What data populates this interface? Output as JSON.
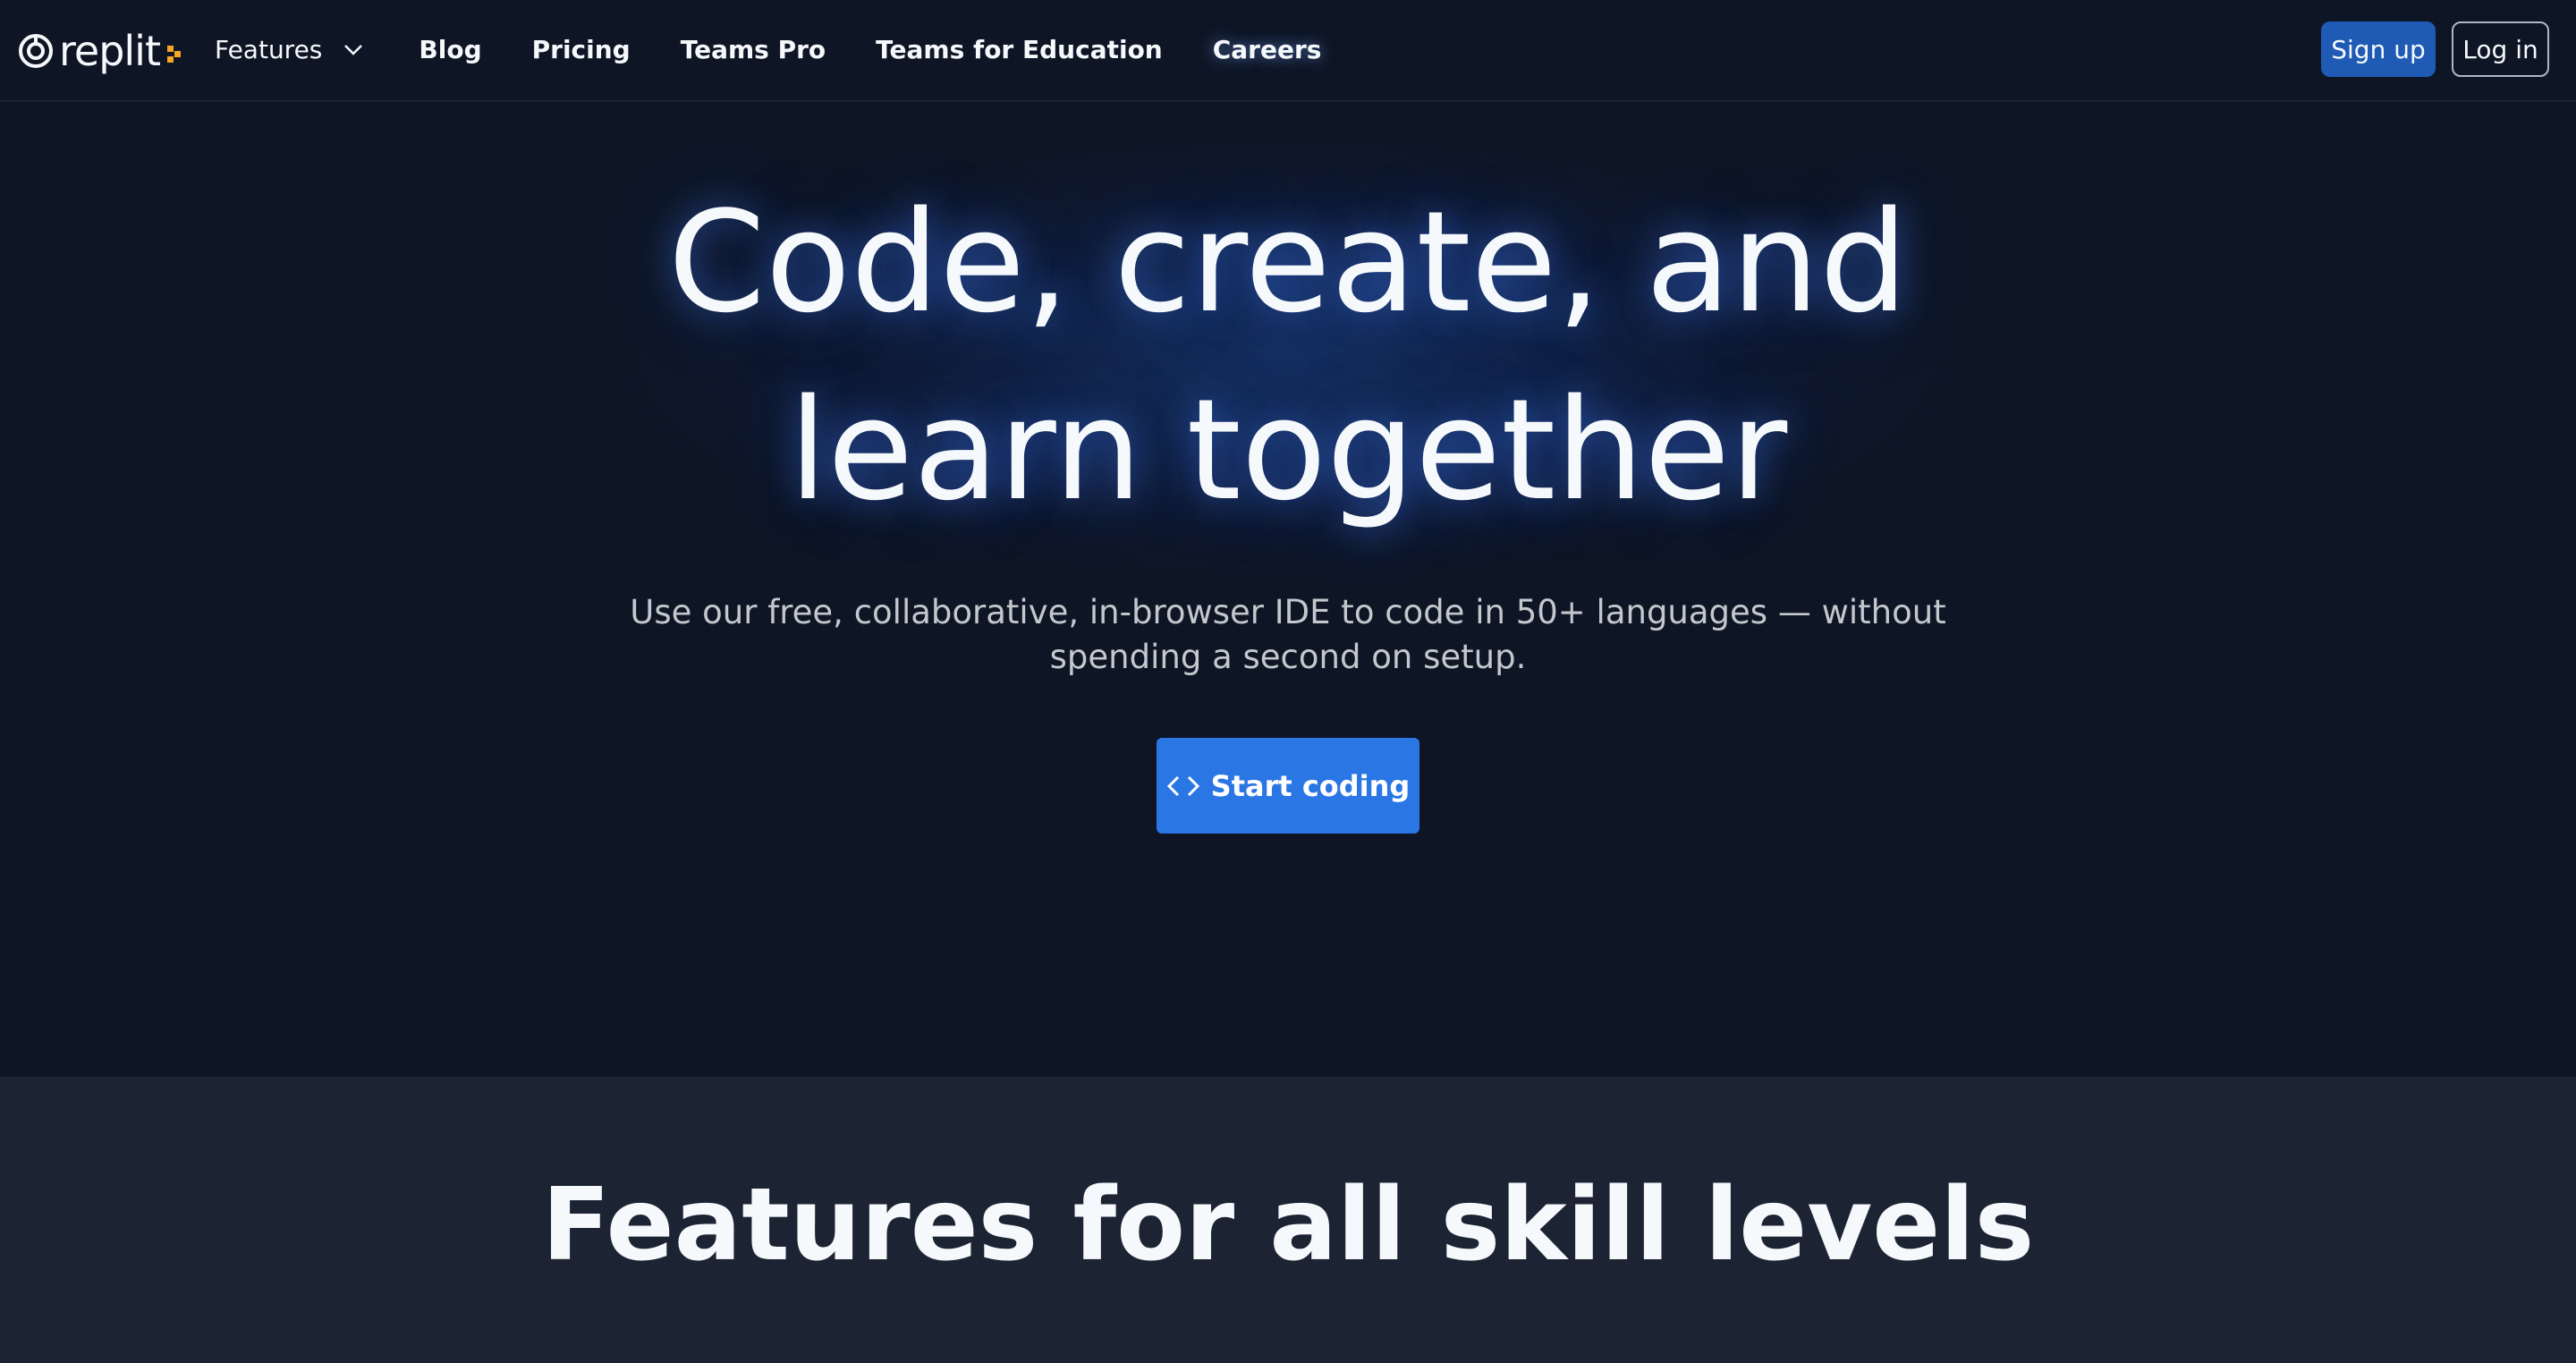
{
  "brand": {
    "wordmark": "replit",
    "colors": {
      "background": "#0e1525",
      "section": "#1c2333",
      "accent_blue": "#2b76e5",
      "signup_blue": "#1f5bb5",
      "logo_orange": "#f5a623"
    }
  },
  "nav": {
    "items": [
      {
        "label": "Features",
        "has_dropdown": true,
        "icon": "chevron-down-icon"
      },
      {
        "label": "Blog"
      },
      {
        "label": "Pricing"
      },
      {
        "label": "Teams Pro"
      },
      {
        "label": "Teams for Education"
      },
      {
        "label": "Careers"
      }
    ],
    "signup_label": "Sign up",
    "login_label": "Log in"
  },
  "hero": {
    "title_line1": "Code, create, and",
    "title_line2": "learn together",
    "subtitle_line1": "Use our free, collaborative, in-browser IDE to code in 50+ languages — without",
    "subtitle_line2": "spending a second on setup.",
    "cta_label": "Start coding",
    "cta_icon": "code-icon"
  },
  "features": {
    "heading": "Features for all skill levels"
  }
}
